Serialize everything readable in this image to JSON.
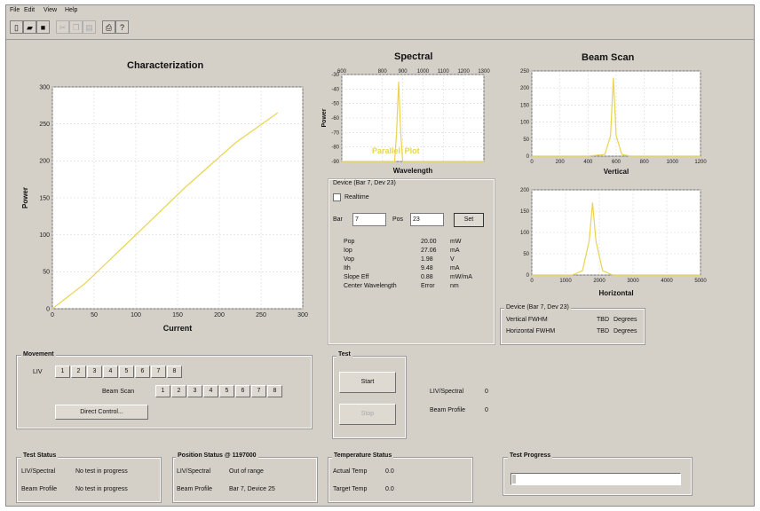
{
  "menu": [
    "File",
    "Edit",
    "View",
    "Help"
  ],
  "toolbar": {
    "icons": [
      "new-file-icon",
      "open-folder-icon",
      "save-icon",
      "cut-icon",
      "copy-icon",
      "paste-icon",
      "print-icon",
      "help-icon"
    ]
  },
  "characterization": {
    "title": "Characterization"
  },
  "spectral": {
    "title": "Spectral",
    "line_labels": [
      "Parallel",
      "Plot"
    ]
  },
  "beam_scan": {
    "title": "Beam Scan"
  },
  "device": {
    "label": "Device (Bar 7, Dev 23)",
    "realtime_label": "Realtime",
    "bar_label": "Bar",
    "bar_value": "7",
    "pos_label": "Pos",
    "pos_value": "23",
    "set_label": "Set",
    "params": [
      {
        "name": "Pop",
        "value": "20.00",
        "unit": "mW"
      },
      {
        "name": "Iop",
        "value": "27.06",
        "unit": "mA"
      },
      {
        "name": "Vop",
        "value": "1.98",
        "unit": "V"
      },
      {
        "name": "Ith",
        "value": "9.48",
        "unit": "mA"
      },
      {
        "name": "Slope Eff",
        "value": "0.88",
        "unit": "mW/mA"
      },
      {
        "name": "Center Wavelength",
        "value": "Error",
        "unit": "nm"
      }
    ]
  },
  "fwhm": {
    "label": "Device (Bar 7, Dev 23)",
    "rows": [
      {
        "name": "Vertical FWHM",
        "value": "TBD",
        "unit": "Degrees"
      },
      {
        "name": "Horizontal FWHM",
        "value": "TBD",
        "unit": "Degrees"
      }
    ]
  },
  "movement": {
    "label": "Movement",
    "liv_label": "LIV",
    "liv_buttons": [
      "1",
      "2",
      "3",
      "4",
      "5",
      "6",
      "7",
      "8"
    ],
    "beam_scan_label": "Beam Scan",
    "beam_buttons": [
      "1",
      "2",
      "3",
      "4",
      "5",
      "6",
      "7",
      "8"
    ],
    "direct_control": "Direct Control..."
  },
  "test": {
    "label": "Test",
    "start": "Start",
    "stop": "Stop",
    "liv_spectral_label": "LIV/Spectral",
    "liv_spectral_value": "0",
    "beam_profile_label": "Beam Profile",
    "beam_profile_value": "0"
  },
  "test_status": {
    "label": "Test Status",
    "rows": [
      {
        "name": "LIV/Spectral",
        "value": "No test in progress"
      },
      {
        "name": "Beam Profile",
        "value": "No test in progress"
      }
    ]
  },
  "position_status": {
    "label": "Position Status @ 1197000",
    "rows": [
      {
        "name": "LIV/Spectral",
        "value": "Out of range"
      },
      {
        "name": "Beam Profile",
        "value": "Bar 7, Device 25"
      }
    ]
  },
  "temperature_status": {
    "label": "Temperature Status",
    "rows": [
      {
        "name": "Actual Temp",
        "value": "0.0"
      },
      {
        "name": "Target Temp",
        "value": "0.0"
      }
    ]
  },
  "test_progress": {
    "label": "Test Progress",
    "progress": 0.02
  },
  "chart_data": [
    {
      "id": "characterization",
      "type": "line",
      "title": "Characterization",
      "xlabel": "Current",
      "ylabel": "Power",
      "xlim": [
        0,
        300
      ],
      "ylim": [
        0,
        300
      ],
      "xticks": [
        0,
        50,
        100,
        150,
        200,
        250,
        300
      ],
      "yticks": [
        0,
        50,
        100,
        150,
        200,
        250,
        300
      ],
      "grid": true,
      "series": [
        {
          "color": "#e8d44d",
          "x": [
            0,
            40,
            100,
            160,
            220,
            270
          ],
          "y": [
            0,
            35,
            100,
            165,
            225,
            265
          ]
        }
      ]
    },
    {
      "id": "spectral",
      "type": "line",
      "title": "Spectral",
      "xlabel": "Wavelength",
      "ylabel": "Power",
      "xlim": [
        600,
        1300
      ],
      "ylim": [
        -90,
        -30
      ],
      "xticks": [
        600,
        800,
        900,
        1000,
        1100,
        1200,
        1300
      ],
      "yticks": [
        -30,
        -40,
        -50,
        -60,
        -70,
        -80,
        -90
      ],
      "ytick_labels": [
        "-30",
        "-40",
        "-50",
        "-60",
        "-70",
        "-80",
        "-90"
      ],
      "grid": true,
      "series": [
        {
          "color": "#e8d44d",
          "x": [
            600,
            700,
            800,
            860,
            870,
            880,
            890,
            900,
            960,
            1050,
            1150,
            1300
          ],
          "y": [
            -90,
            -90,
            -90,
            -90,
            -70,
            -35,
            -70,
            -90,
            -90,
            -90,
            -90,
            -90
          ]
        }
      ]
    },
    {
      "id": "beam_scan_vertical",
      "type": "line",
      "title": "Beam Scan",
      "xlabel": "Vertical",
      "xlim": [
        0,
        1200
      ],
      "ylim": [
        0,
        250
      ],
      "xticks": [
        0,
        200,
        400,
        600,
        800,
        1000,
        1200
      ],
      "yticks": [
        0,
        50,
        100,
        150,
        200,
        250
      ],
      "grid": true,
      "series": [
        {
          "color": "#e8d44d",
          "x": [
            0,
            400,
            520,
            560,
            580,
            600,
            640,
            700,
            1200
          ],
          "y": [
            0,
            0,
            5,
            60,
            230,
            60,
            5,
            0,
            0
          ]
        }
      ]
    },
    {
      "id": "beam_scan_horizontal",
      "type": "line",
      "xlabel": "Horizontal",
      "xlim": [
        0,
        5000
      ],
      "ylim": [
        0,
        200
      ],
      "xticks": [
        0,
        1000,
        2000,
        3000,
        4000,
        5000
      ],
      "yticks": [
        0,
        50,
        100,
        150,
        200
      ],
      "grid": true,
      "series": [
        {
          "color": "#e8d44d",
          "x": [
            0,
            1200,
            1500,
            1700,
            1800,
            1900,
            2100,
            2400,
            5000
          ],
          "y": [
            0,
            0,
            10,
            80,
            170,
            80,
            10,
            0,
            0
          ]
        }
      ]
    }
  ]
}
